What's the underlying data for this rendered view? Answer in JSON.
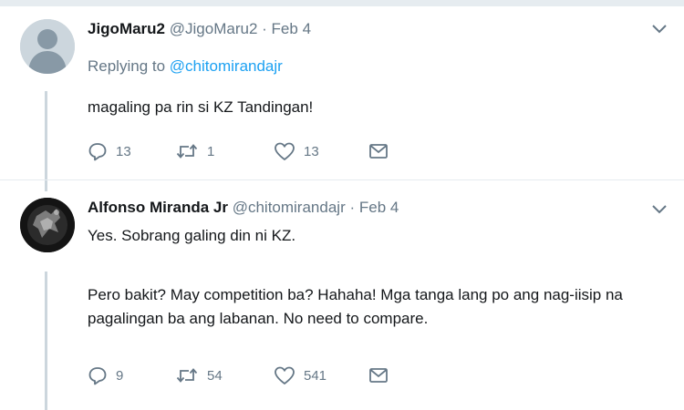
{
  "tweets": [
    {
      "name": "JigoMaru2",
      "handle": "@JigoMaru2",
      "separator": "·",
      "date": "Feb 4",
      "replying_prefix": "Replying to",
      "replying_handle": "@chitomirandajr",
      "text": "magaling pa rin si KZ Tandingan!",
      "replies": "13",
      "retweets": "1",
      "likes": "13"
    },
    {
      "name": "Alfonso Miranda Jr",
      "handle": "@chitomirandajr",
      "separator": "·",
      "date": "Feb 4",
      "text_p1": "Yes. Sobrang galing din ni KZ.",
      "text_p2": "Pero bakit? May competition ba? Hahaha! Mga tanga lang po ang nag-iisip na pagalingan ba ang labanan. No need to compare.",
      "replies": "9",
      "retweets": "54",
      "likes": "541"
    }
  ],
  "icons": {
    "reply": "reply-icon",
    "retweet": "retweet-icon",
    "like": "heart-icon",
    "dm": "envelope-icon",
    "menu": "chevron-down-icon"
  },
  "colors": {
    "link": "#1da1f2",
    "muted": "#657786",
    "thread_line": "#ccd6dd"
  }
}
